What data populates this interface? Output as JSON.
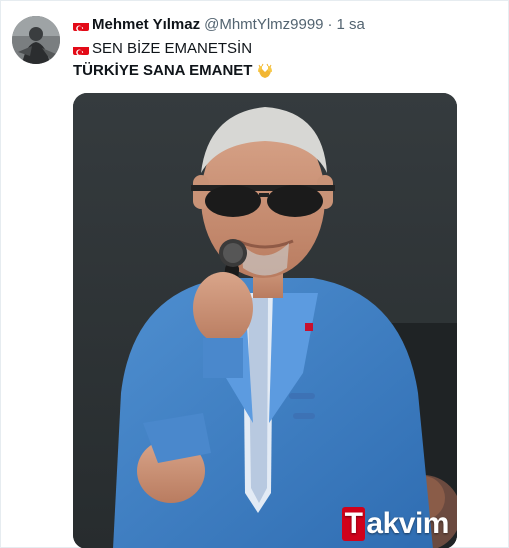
{
  "tweet": {
    "author": {
      "display_name": "Mehmet Yılmaz",
      "handle": "@MhmtYlmz9999",
      "flag_icon": "turkey-flag-icon"
    },
    "separator": "·",
    "time": "1 sa",
    "text": {
      "line1": "SEN BİZE EMANETSİN",
      "line2": "TÜRKİYE SANA EMANET",
      "line2_emoji": "raising-hands-icon"
    },
    "media": {
      "watermark_first": "T",
      "watermark_rest": "akvim"
    }
  },
  "colors": {
    "flag_red": "#e30a17",
    "muted_text": "#536471",
    "primary_text": "#0f1419",
    "watermark_red": "#d0021b"
  }
}
